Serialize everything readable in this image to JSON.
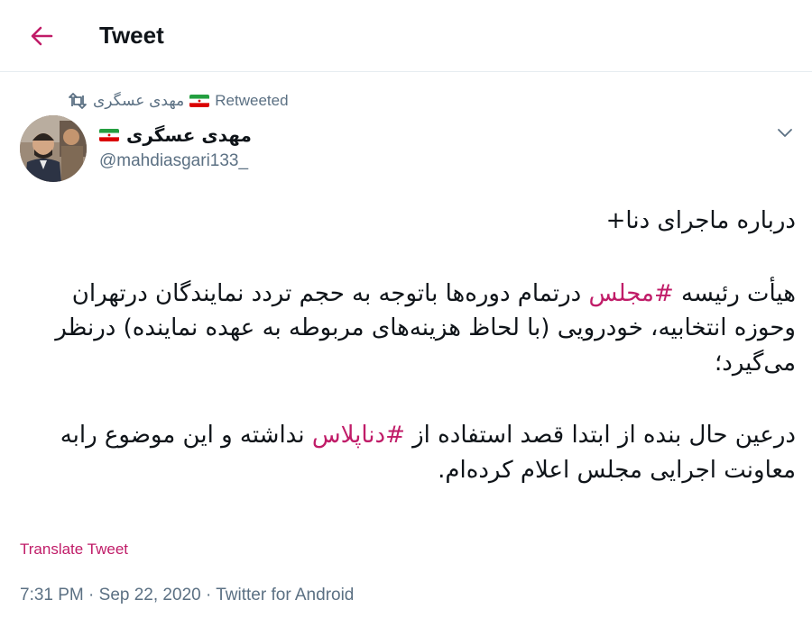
{
  "header": {
    "title": "Tweet",
    "back_icon": "arrow-left-icon",
    "accent_color": "#c01c68"
  },
  "retweet": {
    "icon": "retweet-icon",
    "user": "مهدی عسگری",
    "flag_icon": "iran-flag-icon",
    "label": "Retweeted"
  },
  "author": {
    "name": "مهدی عسگری",
    "flag_icon": "iran-flag-icon",
    "handle": "@mahdiasgari133_"
  },
  "tweet": {
    "line1": "درباره ماجرای دنا+",
    "p2_before": "هیأت رئیسه ",
    "hashtag1": "#مجلس",
    "p2_after": " درتمام دوره‌ها باتوجه به حجم تردد نمایندگان درتهران وحوزه انتخابیه، خودرویی (با لحاظ هزینه‌های مربوطه به عهده نماینده) درنظر می‌گیرد؛",
    "p3_before": "درعین حال بنده از ابتدا قصد استفاده از ",
    "hashtag2": "#دناپلاس",
    "p3_after": " نداشته و این موضوع رابه معاونت اجرایی مجلس اعلام کرده‌ام."
  },
  "translate_label": "Translate Tweet",
  "meta": {
    "time": "7:31 PM",
    "sep1": " · ",
    "date": "Sep 22, 2020",
    "sep2": " · ",
    "source": "Twitter for Android"
  },
  "colors": {
    "hashtag": "#c01c68",
    "secondary_text": "#5b7083",
    "divider": "#e6ecf0"
  }
}
